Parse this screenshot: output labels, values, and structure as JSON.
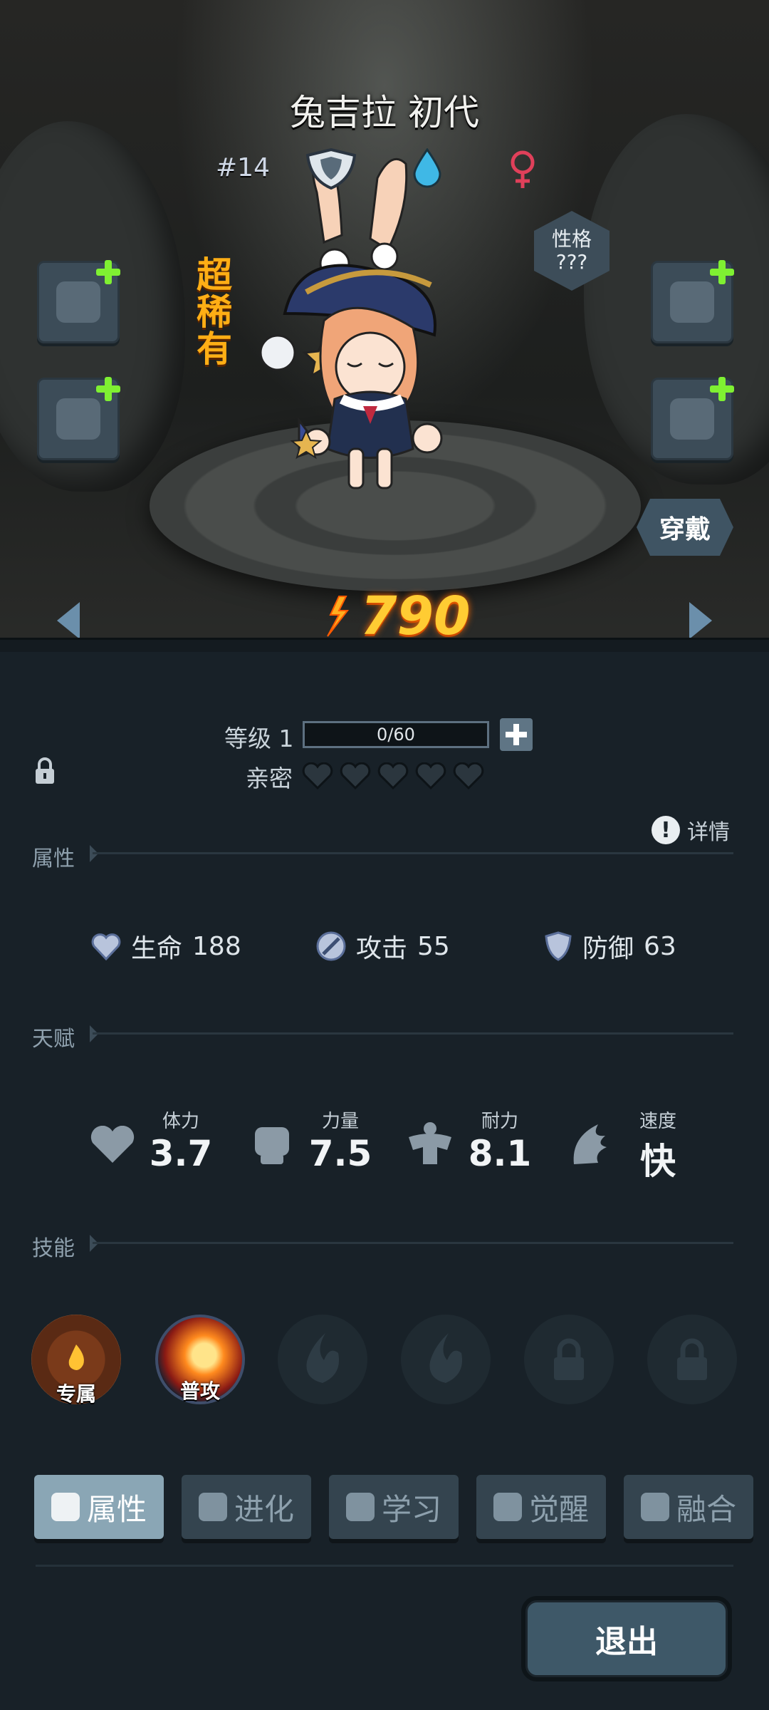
{
  "character": {
    "name": "兔吉拉 初代",
    "number": "#14",
    "rarity": "超稀有",
    "personality_label": "性格",
    "personality_value": "???",
    "power": "790",
    "wear_label": "穿戴"
  },
  "progress": {
    "level_label": "等级 1",
    "exp_text": "0/60",
    "exp_fraction": 0,
    "intimacy_label": "亲密",
    "intimacy_hearts_filled": 0,
    "intimacy_hearts_total": 5
  },
  "sections": {
    "attributes_title": "属性",
    "talent_title": "天赋",
    "skills_title": "技能",
    "detail_label": "详情"
  },
  "stats": [
    {
      "label": "生命",
      "value": "188",
      "icon": "heart-shield-icon"
    },
    {
      "label": "攻击",
      "value": "55",
      "icon": "sword-icon"
    },
    {
      "label": "防御",
      "value": "63",
      "icon": "shield-icon"
    }
  ],
  "talents": [
    {
      "label": "体力",
      "value": "3.7",
      "icon": "heart-icon"
    },
    {
      "label": "力量",
      "value": "7.5",
      "icon": "fist-icon"
    },
    {
      "label": "耐力",
      "value": "8.1",
      "icon": "muscle-icon"
    },
    {
      "label": "速度",
      "value": "快",
      "icon": "wing-icon"
    }
  ],
  "skills": [
    {
      "caption": "专属",
      "state": "exclusive"
    },
    {
      "caption": "普攻",
      "state": "normal"
    },
    {
      "caption": "",
      "state": "empty"
    },
    {
      "caption": "",
      "state": "empty"
    },
    {
      "caption": "",
      "state": "locked"
    },
    {
      "caption": "",
      "state": "locked"
    }
  ],
  "tabs": [
    {
      "label": "属性",
      "icon": "paw-icon",
      "active": true
    },
    {
      "label": "进化",
      "icon": "arrow-up-icon",
      "active": false
    },
    {
      "label": "学习",
      "icon": "book-icon",
      "active": false
    },
    {
      "label": "觉醒",
      "icon": "wolf-icon",
      "active": false
    },
    {
      "label": "融合",
      "icon": "fusion-icon",
      "active": false
    }
  ],
  "exit_label": "退出",
  "colors": {
    "background": "#182128",
    "rarity": "#ffae15",
    "power": "#ffcc33",
    "element_water": "#3fb8e6",
    "gender_female": "#e0405a",
    "equip_plus": "#7ff032",
    "active_tab": "#8aa6b5"
  }
}
